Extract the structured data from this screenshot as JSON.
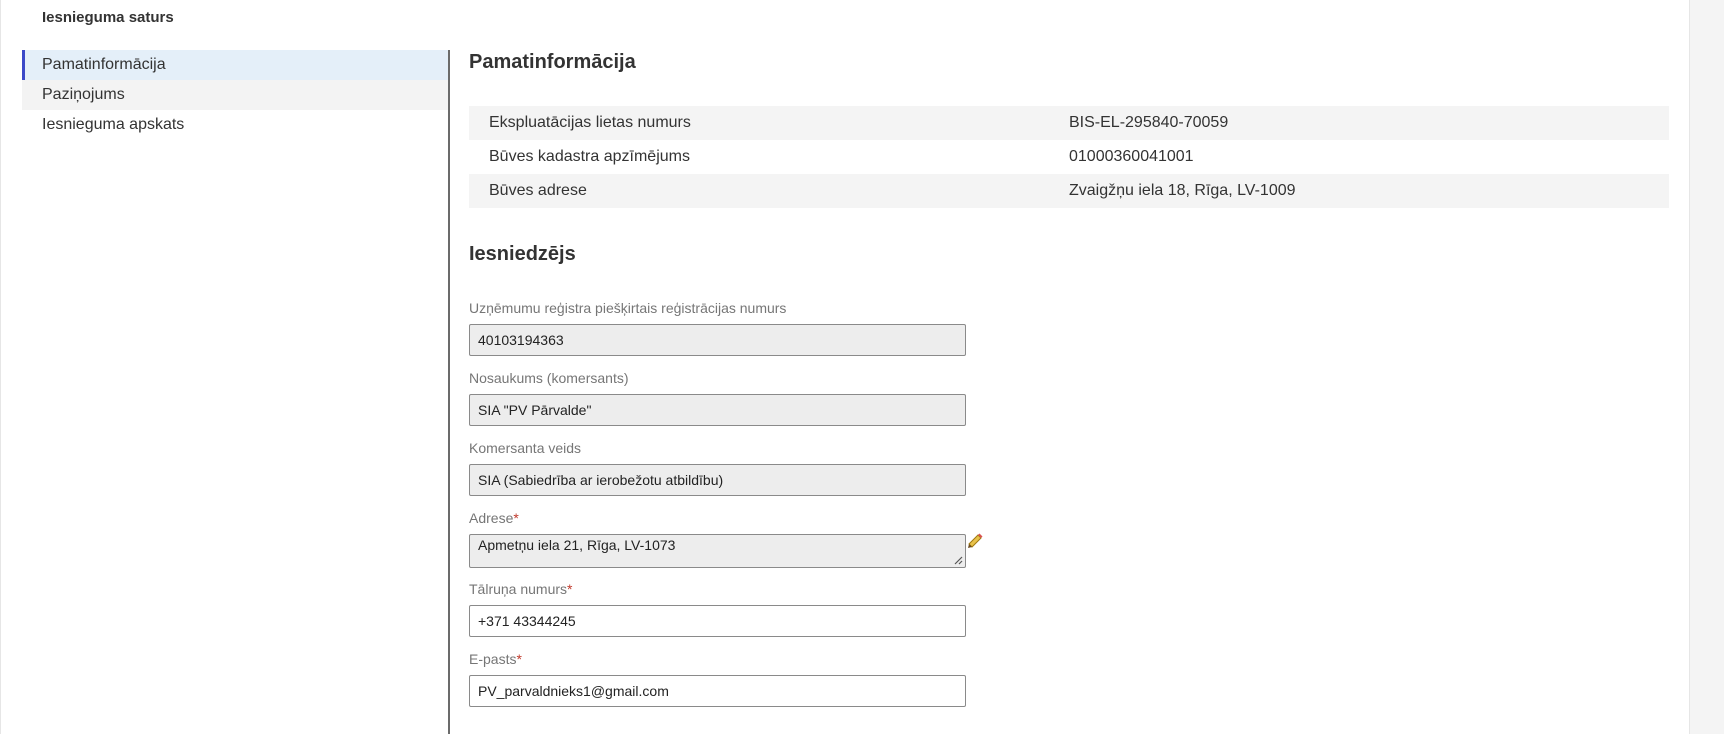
{
  "page": {
    "heading": "Iesnieguma saturs"
  },
  "sidebar": {
    "items": [
      {
        "label": "Pamatinformācija"
      },
      {
        "label": "Paziņojums"
      },
      {
        "label": "Iesnieguma apskats"
      }
    ]
  },
  "basic_info": {
    "title": "Pamatinformācija",
    "rows": [
      {
        "label": "Ekspluatācijas lietas numurs",
        "value": "BIS-EL-295840-70059"
      },
      {
        "label": "Būves kadastra apzīmējums",
        "value": "01000360041001"
      },
      {
        "label": "Būves adrese",
        "value": "Zvaigžņu iela 18, Rīga, LV-1009"
      }
    ]
  },
  "applicant": {
    "title": "Iesniedzējs",
    "fields": {
      "reg_number": {
        "label": "Uzņēmumu reģistra piešķirtais reģistrācijas numurs",
        "value": "40103194363"
      },
      "name": {
        "label": "Nosaukums (komersants)",
        "value": "SIA \"PV Pārvalde\""
      },
      "company_type": {
        "label": "Komersanta veids",
        "value": "SIA (Sabiedrība ar ierobežotu atbildību)"
      },
      "address": {
        "label": "Adrese",
        "required_mark": "*",
        "value": "Apmetņu iela 21, Rīga, LV-1073"
      },
      "phone": {
        "label": "Tālruņa numurs",
        "required_mark": "*",
        "value": "+371 43344245"
      },
      "email": {
        "label": "E-pasts",
        "required_mark": "*",
        "value": "PV_parvaldnieks1@gmail.com"
      }
    }
  },
  "colors": {
    "active_accent": "#3b49c8",
    "required": "#c0392b",
    "edit_icon": "#e0b020"
  },
  "icons": {
    "edit": "pencil-icon",
    "resize": "resize-grip-icon"
  }
}
